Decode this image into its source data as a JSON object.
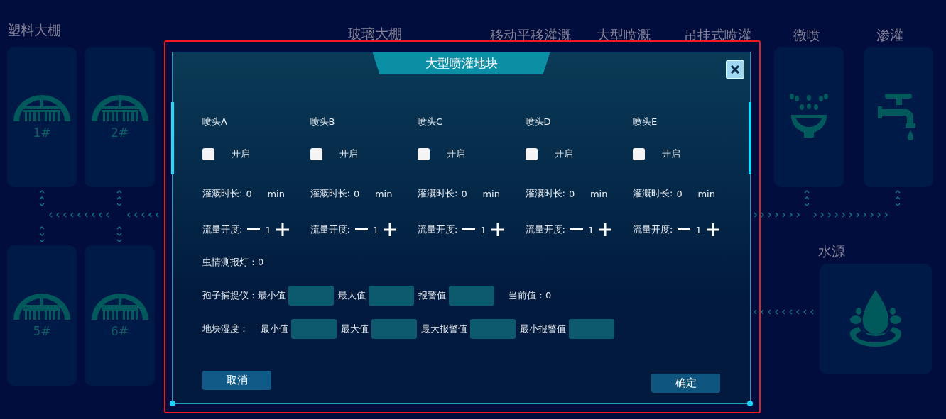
{
  "zones": [
    {
      "title": "塑料大棚"
    },
    {
      "title": "玻璃大棚"
    },
    {
      "title": "移动平移灌溉"
    },
    {
      "title": "大型喷溉"
    },
    {
      "title": "吊挂式喷灌"
    },
    {
      "title": "微喷"
    },
    {
      "title": "渗灌"
    },
    {
      "title": "水源"
    }
  ],
  "cards": [
    {
      "kind": "greenhouse",
      "label": "1#"
    },
    {
      "kind": "greenhouse",
      "label": "2#"
    },
    {
      "kind": "greenhouse",
      "label": "5#"
    },
    {
      "kind": "greenhouse",
      "label": "6#"
    },
    {
      "kind": "sprinkler"
    },
    {
      "kind": "faucet"
    },
    {
      "kind": "water"
    }
  ],
  "dialog": {
    "title": "大型喷灌地块",
    "nozzles": [
      {
        "name": "喷头A",
        "switch_label": "开启",
        "checked": false,
        "duration_label": "灌溉时长:",
        "duration": "0",
        "unit": "min",
        "flow_label": "流量开度:",
        "flow": "1"
      },
      {
        "name": "喷头B",
        "switch_label": "开启",
        "checked": false,
        "duration_label": "灌溉时长:",
        "duration": "0",
        "unit": "min",
        "flow_label": "流量开度:",
        "flow": "1"
      },
      {
        "name": "喷头C",
        "switch_label": "开启",
        "checked": false,
        "duration_label": "灌溉时长:",
        "duration": "0",
        "unit": "min",
        "flow_label": "流量开度:",
        "flow": "1"
      },
      {
        "name": "喷头D",
        "switch_label": "开启",
        "checked": false,
        "duration_label": "灌溉时长:",
        "duration": "0",
        "unit": "min",
        "flow_label": "流量开度:",
        "flow": "1"
      },
      {
        "name": "喷头E",
        "switch_label": "开启",
        "checked": false,
        "duration_label": "灌溉时长:",
        "duration": "0",
        "unit": "min",
        "flow_label": "流量开度:",
        "flow": "1"
      }
    ],
    "pest_lamp": {
      "label": "虫情测报灯：",
      "value": "0"
    },
    "spore_trap": {
      "label": "孢子捕捉仪：",
      "fields": [
        {
          "label": "最小值"
        },
        {
          "label": "最大值"
        },
        {
          "label": "报警值"
        }
      ],
      "current_label": "当前值：",
      "current": "0"
    },
    "soil_moisture": {
      "label": "地块湿度：",
      "fields": [
        {
          "label": "最小值"
        },
        {
          "label": "最大值"
        },
        {
          "label": "最大报警值"
        },
        {
          "label": "最小报警值"
        }
      ]
    },
    "buttons": [
      {
        "kind": "cancel",
        "label": "取消"
      },
      {
        "kind": "confirm",
        "label": "确定"
      }
    ]
  }
}
